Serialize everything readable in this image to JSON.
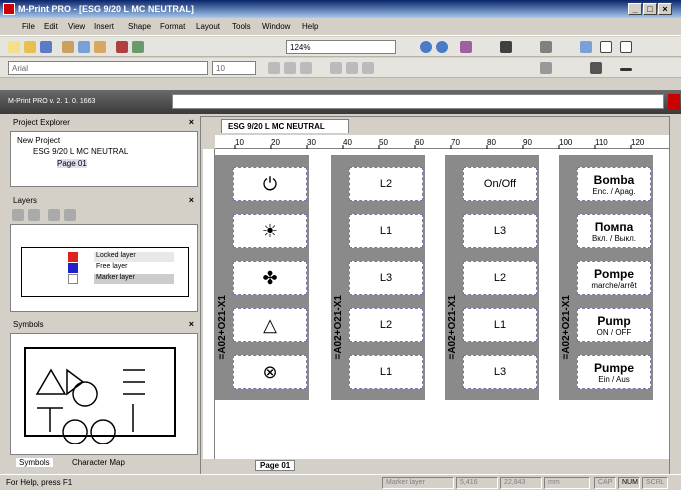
{
  "window": {
    "title": "M-Print PRO - [ESG 9/20 L MC NEUTRAL]"
  },
  "menu": [
    "File",
    "Edit",
    "View",
    "Insert",
    "Shape",
    "Format",
    "Layout",
    "Tools",
    "Window",
    "Help"
  ],
  "toolbar": {
    "zoom": "124%",
    "font": "Arial",
    "font_size": "10"
  },
  "version": "M-Print PRO v. 2. 1. 0. 1663",
  "project_explorer": {
    "title": "Project Explorer",
    "project": "New Project",
    "item": "ESG 9/20 L MC NEUTRAL",
    "page": "Page 01"
  },
  "layers": {
    "title": "Layers",
    "rows": [
      "Locked layer",
      "Free layer",
      "Marker layer"
    ]
  },
  "symbols": {
    "title": "Symbols",
    "tab1": "Symbols",
    "tab2": "Character Map"
  },
  "doc": {
    "tab": "ESG 9/20 L MC NEUTRAL",
    "page_tab": "Page 01"
  },
  "ruler_labels": [
    "10",
    "20",
    "30",
    "40",
    "50",
    "60",
    "70",
    "80",
    "90",
    "100",
    "110",
    "120"
  ],
  "strips": [
    {
      "label": "=A02+O21-X1",
      "cells": [
        {
          "icon": "power-icon"
        },
        {
          "icon": "light-icon"
        },
        {
          "icon": "fan-icon"
        },
        {
          "icon": "motor-icon"
        },
        {
          "icon": "ex-icon"
        }
      ]
    },
    {
      "label": "=A02+O21-X1",
      "cells": [
        "L2",
        "L1",
        "L3",
        "L2",
        "L1"
      ]
    },
    {
      "label": "=A02+O21-X1",
      "cells": [
        "On/Off",
        "L3",
        "L2",
        "L1",
        "L3"
      ]
    },
    {
      "label": "=A02+O21-X1",
      "cells": [
        {
          "big": "Bomba",
          "small": "Enc. / Apag."
        },
        {
          "big": "Помпа",
          "small": "Вкл. / Выкл."
        },
        {
          "big": "Pompe",
          "small": "marche/arrêt"
        },
        {
          "big": "Pump",
          "small": "ON / OFF"
        },
        {
          "big": "Pumpe",
          "small": "Ein / Aus"
        }
      ]
    }
  ],
  "statusbar": {
    "help": "For Help, press F1",
    "layer": "Marker layer",
    "x": "5,416",
    "y": "22,843",
    "unit": "mm",
    "caps": "CAP",
    "num": "NUM",
    "scrl": "SCRL"
  }
}
